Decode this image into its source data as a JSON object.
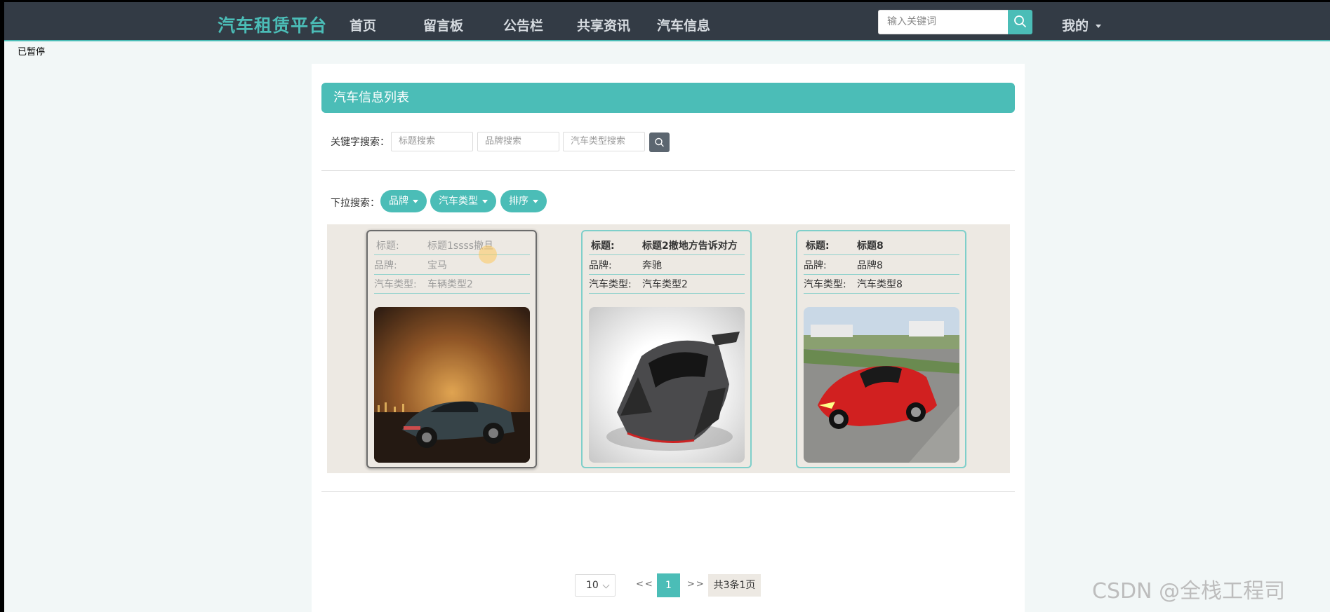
{
  "nav": {
    "brand": "汽车租赁平台",
    "links": [
      "首页",
      "留言板",
      "公告栏",
      "共享资讯",
      "汽车信息"
    ],
    "search_placeholder": "输入关键词",
    "mine": "我的"
  },
  "status_label": "已暂停",
  "panel": {
    "title": "汽车信息列表",
    "keyword_label": "关键字搜索：",
    "inputs": [
      "标题搜索",
      "品牌搜索",
      "汽车类型搜索"
    ],
    "dropdown_label": "下拉搜索：",
    "dropdowns": [
      "品牌",
      "汽车类型",
      "排序"
    ]
  },
  "cards": [
    {
      "title_key": "标题:",
      "title": "标题1ssss撤旦",
      "brand_key": "品牌:",
      "brand": "宝马",
      "type_key": "汽车类型:",
      "type": "车辆类型2"
    },
    {
      "title_key": "标题:",
      "title": "标题2撤地方告诉对方",
      "brand_key": "品牌:",
      "brand": "奔驰",
      "type_key": "汽车类型:",
      "type": "汽车类型2"
    },
    {
      "title_key": "标题:",
      "title": "标题8",
      "brand_key": "品牌:",
      "brand": "品牌8",
      "type_key": "汽车类型:",
      "type": "汽车类型8"
    }
  ],
  "pager": {
    "size": "10",
    "prev": "<<",
    "current": "1",
    "next": ">>",
    "total": "共3条1页"
  },
  "watermark": "CSDN @全栈工程司",
  "colors": {
    "accent": "#4bbdb7",
    "nav_bg": "#333b45"
  }
}
